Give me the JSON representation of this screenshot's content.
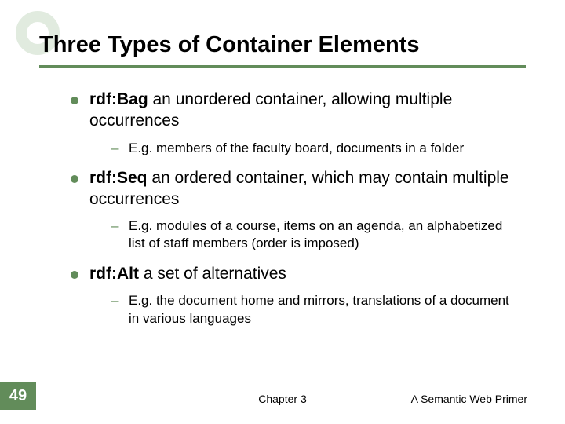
{
  "chart_data": null,
  "slide": {
    "title": "Three Types of Container Elements",
    "bullets": [
      {
        "term": "rdf:Bag",
        "rest": " an unordered container, allowing multiple occurrences",
        "subs": [
          "E.g. members of the faculty board, documents in a folder"
        ]
      },
      {
        "term": "rdf:Seq",
        "rest": " an ordered container, which may contain multiple occurrences",
        "subs": [
          "E.g. modules of a course, items on an agenda, an alphabetized list of staff members (order is imposed)"
        ]
      },
      {
        "term": "rdf:Alt",
        "rest": " a set of alternatives",
        "subs": [
          "E.g. the document home and mirrors, translations of a document in various languages"
        ]
      }
    ],
    "footer": {
      "page": "49",
      "center": "Chapter 3",
      "right": "A Semantic Web Primer"
    }
  }
}
